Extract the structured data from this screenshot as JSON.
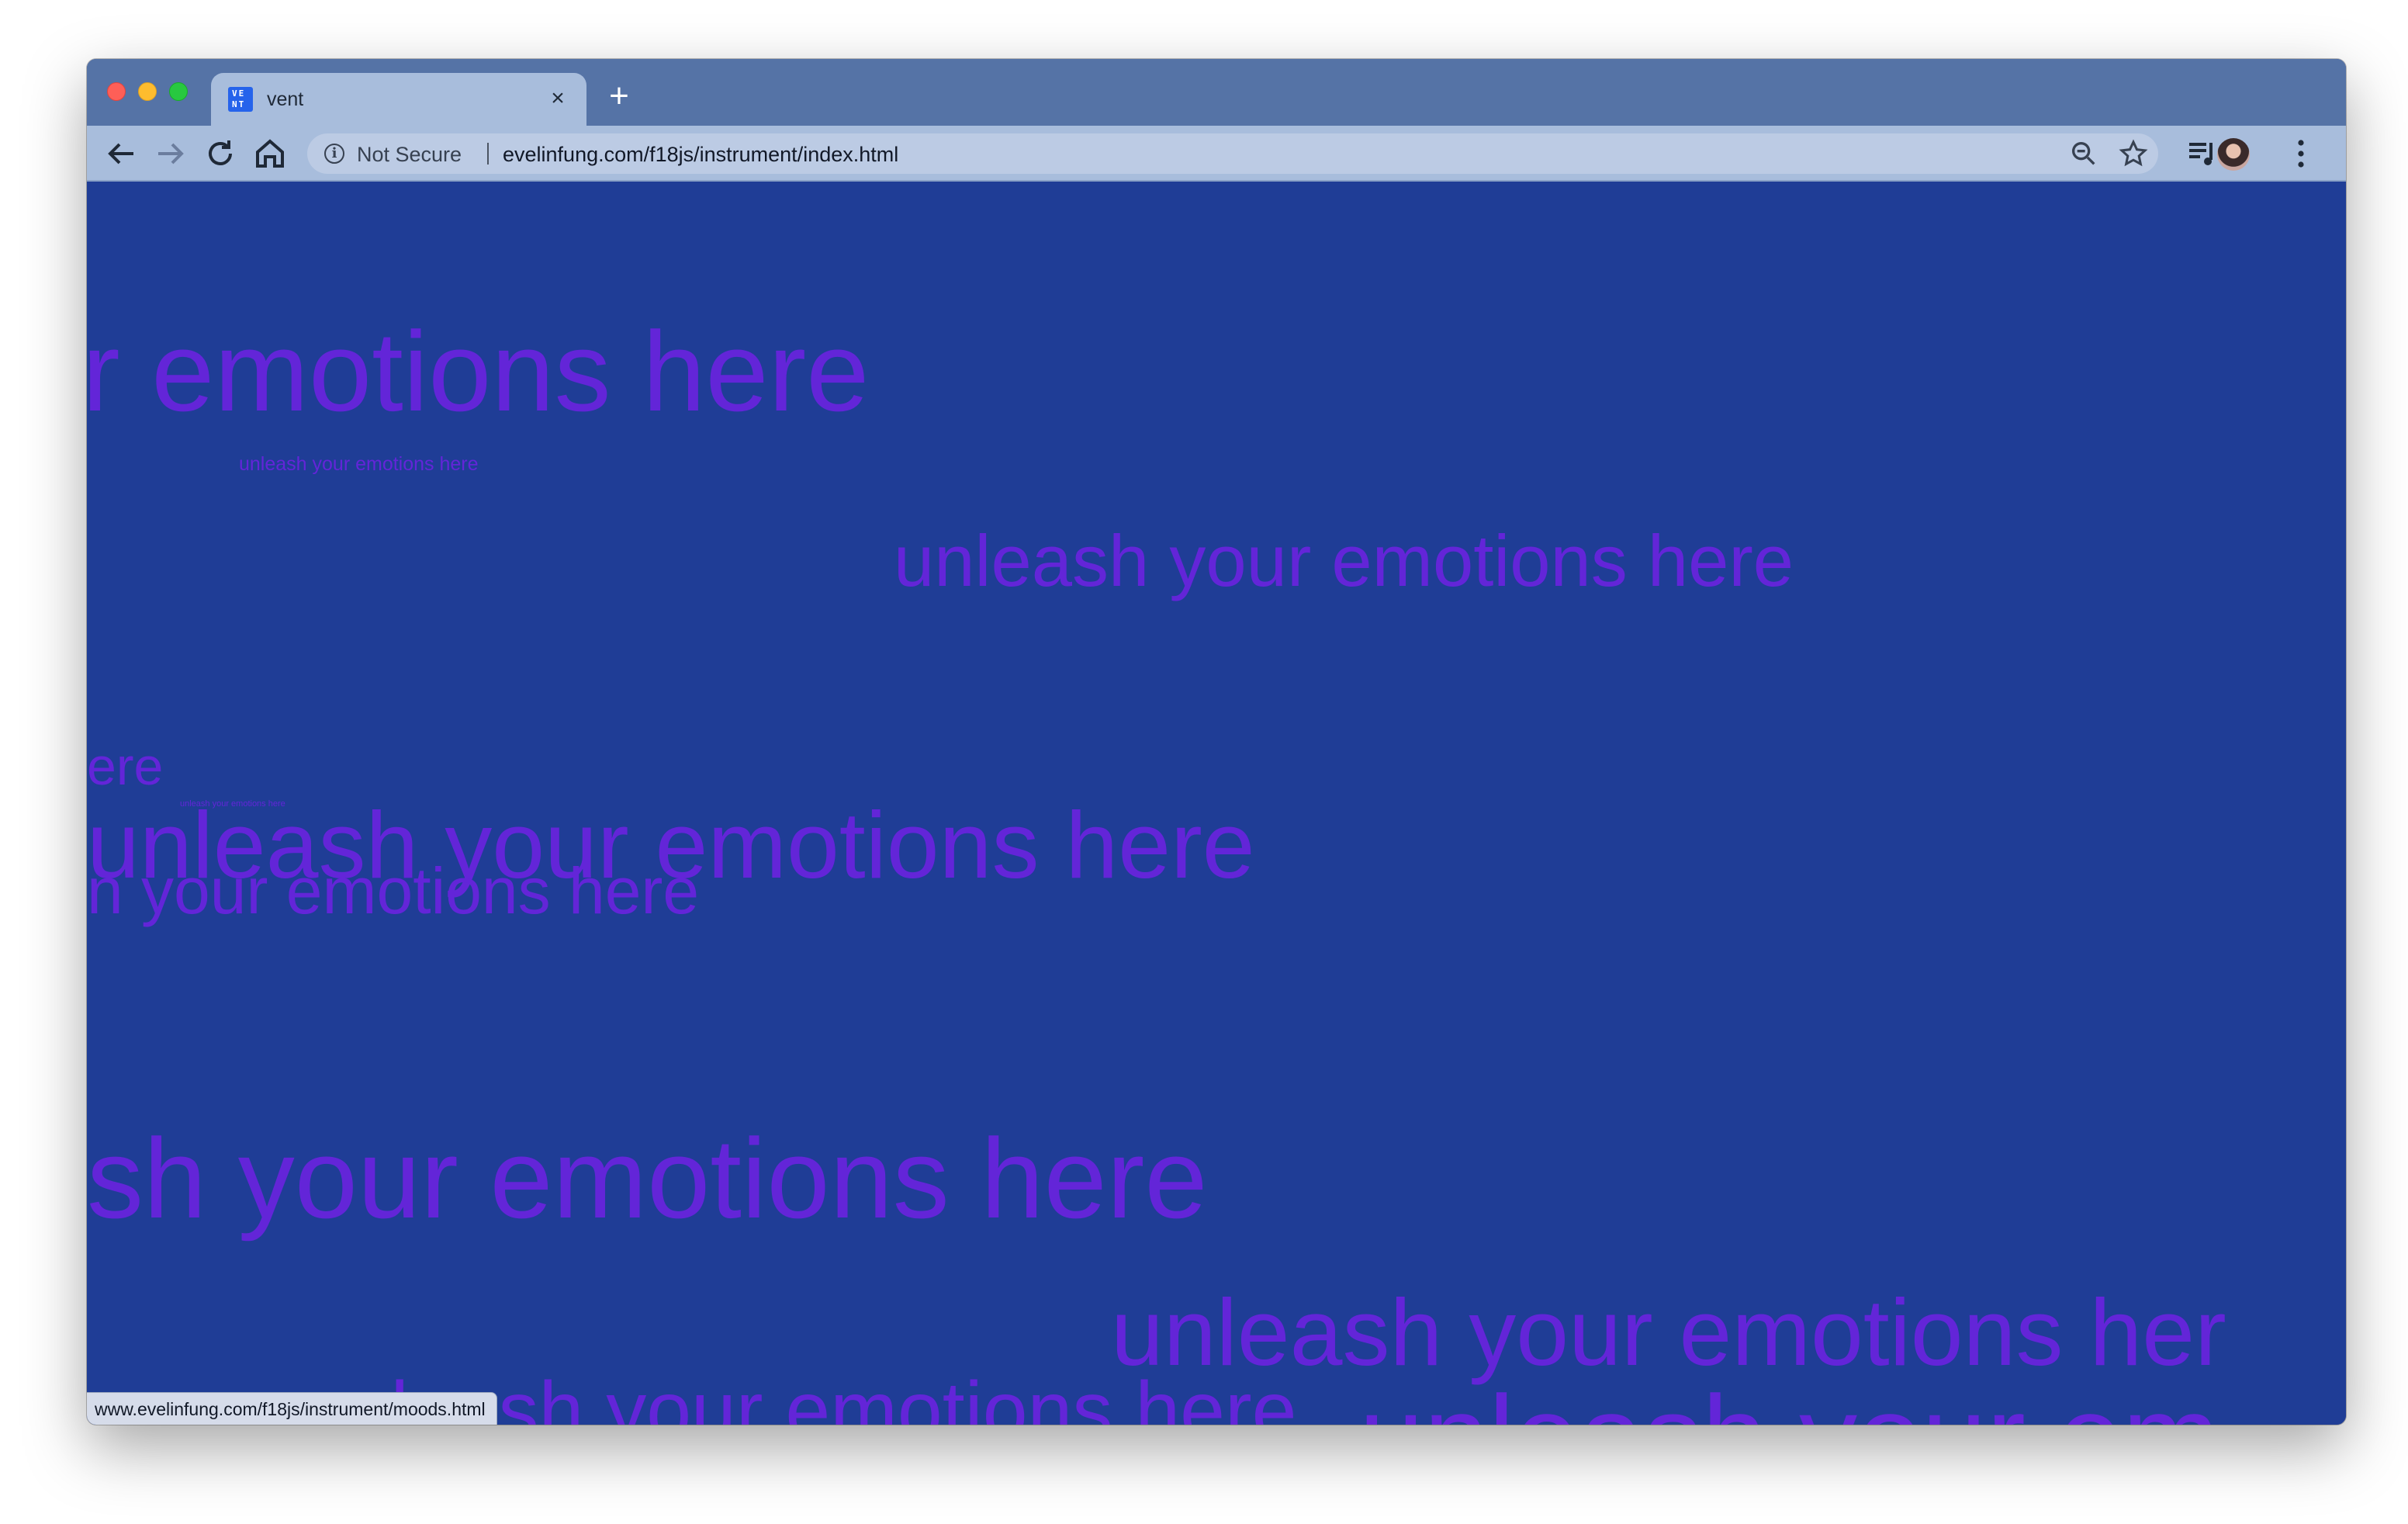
{
  "browser": {
    "tab": {
      "title": "vent",
      "favicon_text": "VE NT"
    },
    "new_tab_label": "+",
    "security_label": "Not Secure",
    "url": "evelinfung.com/f18js/instrument/index.html",
    "status_url": "www.evelinfung.com/f18js/instrument/moods.html"
  },
  "page": {
    "background_color": "#1f3d96",
    "text_color": "#6325d8",
    "phrases": [
      {
        "text": "r emotions here"
      },
      {
        "text": "unleash your emotions here"
      },
      {
        "text": "unleash your emotions here"
      },
      {
        "text": "ere"
      },
      {
        "text": "unleash your emotions here"
      },
      {
        "text": "unleash your emotions here"
      },
      {
        "text": "n your emotions here"
      },
      {
        "text": "sh your emotions here"
      },
      {
        "text": "unleash your emotions her"
      },
      {
        "text": "unleash your emotions here"
      },
      {
        "text": "unleash your em"
      }
    ]
  }
}
